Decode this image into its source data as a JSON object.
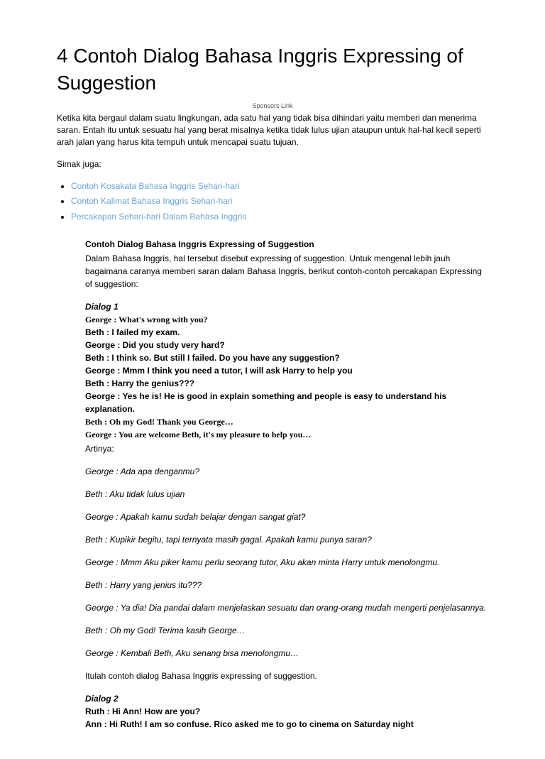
{
  "title": "4 Contoh Dialog Bahasa Inggris Expressing of Suggestion",
  "sponsors": "Sponsors Link",
  "intro": "Ketika kita bergaul dalam suatu lingkungan, ada satu hal yang tidak bisa dihindari yaitu memberi dan menerima saran. Entah itu untuk sesuatu hal yang berat misalnya ketika tidak lulus ujian ataupun untuk hal-hal kecil seperti arah jalan yang harus kita tempuh untuk mencapai suatu tujuan.",
  "see_also": "Simak juga:",
  "links": [
    "Contoh Kosakata Bahasa Inggris Sehari-hari",
    "Contoh Kalimat Bahasa Inggris Sehari-hari",
    "Percakapan Sehari-hari Dalam Bahasa Inggris"
  ],
  "section": {
    "title": "Contoh Dialog Bahasa Inggris Expressing of Suggestion",
    "desc": "Dalam Bahasa Inggris, hal tersebut disebut expressing of suggestion. Untuk mengenal lebih jauh bagaimana caranya memberi saran dalam Bahasa Inggris, berikut contoh-contoh percakapan Expressing of suggestion:"
  },
  "dialog1": {
    "label": "Dialog 1",
    "l1": "George : What's wrong with you?",
    "l2": "Beth : I failed my exam.",
    "l3": "George : Did you study very hard?",
    "l4": "Beth : I think so. But still I failed. Do you have any suggestion?",
    "l5": "George : Mmm I think you  need a tutor, I will ask Harry to help you",
    "l6": "Beth : Harry the genius???",
    "l7": "George : Yes he is! He is good in explain something and people is easy to understand his explanation.",
    "l8": "Beth : Oh my God! Thank you George…",
    "l9": "George : You are welcome Beth, it's my pleasure to help you…",
    "artinya": "Artinya:",
    "t1": "George : Ada apa denganmu?",
    "t2": "Beth : Aku tidak lulus ujian",
    "t3": "George : Apakah kamu sudah belajar dengan sangat giat?",
    "t4": "Beth : Kupikir begitu, tapi ternyata masih gagal. Apakah kamu punya saran?",
    "t5": "George : Mmm Aku piker kamu perlu seorang tutor, Aku akan minta Harry untuk menolongmu.",
    "t6": "Beth : Harry yang jenius itu???",
    "t7": "George : Ya dia! Dia pandai dalam menjelaskan sesuatu dan orang-orang mudah mengerti penjelasannya.",
    "t8": "Beth : Oh my God! Terima kasih George…",
    "t9": "George : Kembali Beth, Aku senang bisa menolongmu…",
    "closing": "Itulah contoh dialog Bahasa Inggris expressing of suggestion."
  },
  "dialog2": {
    "label": "Dialog 2",
    "l1": "Ruth : Hi Ann! How are you?",
    "l2": "Ann : Hi Ruth! I am so confuse. Rico asked me to go to cinema on Saturday night"
  }
}
